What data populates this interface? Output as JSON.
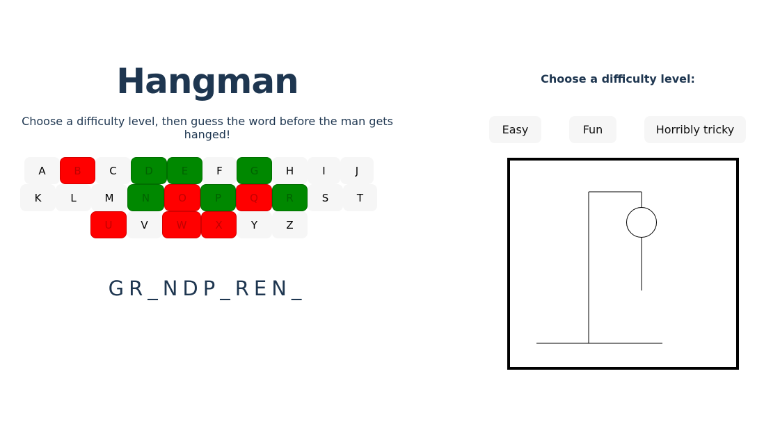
{
  "header": {
    "title": "Hangman",
    "subtitle": "Choose a difficulty level, then guess the word before the man gets hanged!"
  },
  "keyboard": {
    "rows": [
      [
        {
          "letter": "A",
          "state": "unused"
        },
        {
          "letter": "B",
          "state": "wrong"
        },
        {
          "letter": "C",
          "state": "unused"
        },
        {
          "letter": "D",
          "state": "right"
        },
        {
          "letter": "E",
          "state": "right"
        },
        {
          "letter": "F",
          "state": "unused"
        },
        {
          "letter": "G",
          "state": "right"
        },
        {
          "letter": "H",
          "state": "unused"
        },
        {
          "letter": "I",
          "state": "unused"
        },
        {
          "letter": "J",
          "state": "unused"
        }
      ],
      [
        {
          "letter": "K",
          "state": "unused"
        },
        {
          "letter": "L",
          "state": "unused"
        },
        {
          "letter": "M",
          "state": "unused"
        },
        {
          "letter": "N",
          "state": "right"
        },
        {
          "letter": "O",
          "state": "wrong"
        },
        {
          "letter": "P",
          "state": "right"
        },
        {
          "letter": "Q",
          "state": "wrong"
        },
        {
          "letter": "R",
          "state": "right"
        },
        {
          "letter": "S",
          "state": "unused"
        },
        {
          "letter": "T",
          "state": "unused"
        }
      ],
      [
        {
          "letter": "U",
          "state": "wrong"
        },
        {
          "letter": "V",
          "state": "unused"
        },
        {
          "letter": "W",
          "state": "wrong"
        },
        {
          "letter": "X",
          "state": "wrong"
        },
        {
          "letter": "Y",
          "state": "unused"
        },
        {
          "letter": "Z",
          "state": "unused"
        }
      ]
    ],
    "colors": {
      "unused": "#f6f6f6",
      "wrong": "#ff0000",
      "right": "#008800"
    }
  },
  "word_display": "GR_NDP_REN_",
  "difficulty": {
    "heading": "Choose a difficulty level:",
    "options": [
      "Easy",
      "Fun",
      "Horribly tricky"
    ]
  },
  "gallows": {
    "wrong_guesses_shown": 2,
    "parts_drawn": [
      "head",
      "body"
    ]
  }
}
